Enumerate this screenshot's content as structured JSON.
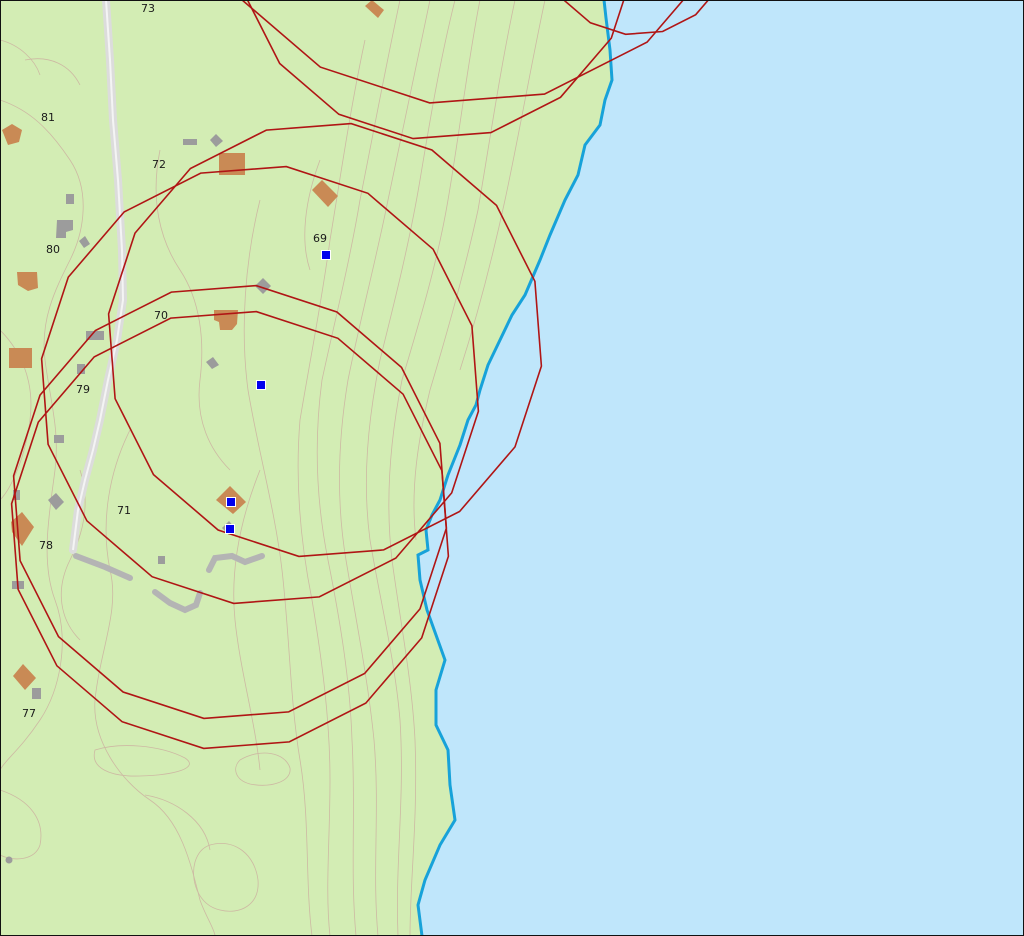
{
  "map": {
    "colors": {
      "land": "#d3edb4",
      "water": "#bfe6fb",
      "shoreline": "#17a2d9",
      "contour": "#cdb9a3",
      "road": "#dcdcdc",
      "track": "#b4b4b4",
      "building_house": "#c98a55",
      "building_shed": "#9c9c9c",
      "range_circle": "#b01515",
      "marker": "#0000ee"
    },
    "labels": [
      {
        "id": "73",
        "text": "73"
      },
      {
        "id": "81",
        "text": "81"
      },
      {
        "id": "72",
        "text": "72"
      },
      {
        "id": "69",
        "text": "69"
      },
      {
        "id": "80",
        "text": "80"
      },
      {
        "id": "70",
        "text": "70"
      },
      {
        "id": "79",
        "text": "79"
      },
      {
        "id": "71",
        "text": "71"
      },
      {
        "id": "78",
        "text": "78"
      },
      {
        "id": "77",
        "text": "77"
      }
    ],
    "markers": [
      "point-marker",
      "point-marker",
      "point-marker",
      "point-marker"
    ],
    "icons": {
      "marker": "blue-square-icon",
      "house": "building-icon",
      "shed": "outbuilding-icon"
    }
  }
}
